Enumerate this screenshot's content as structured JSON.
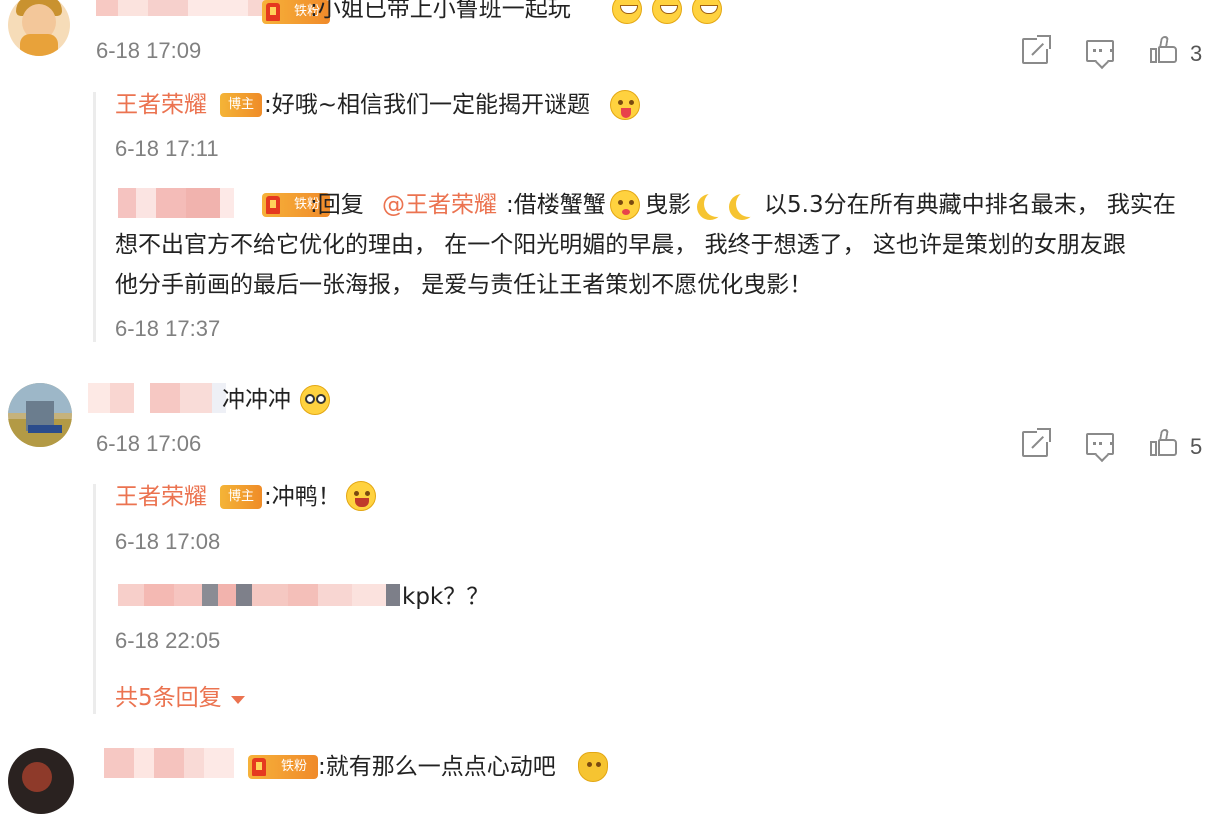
{
  "comments": [
    {
      "badge": "铁粉",
      "text": ":小姐已带上小鲁班一起玩",
      "time": "6-18 17:09",
      "likes": "3",
      "replies": [
        {
          "author": "王者荣耀",
          "badge": "博主",
          "text": ":好哦~相信我们一定能揭开谜题",
          "time": "6-18 17:11"
        },
        {
          "badge": "铁粉",
          "reply_prefix": ":回复",
          "mention": "@王者荣耀",
          "text_a": ":借楼蟹蟹",
          "text_b": "曳影",
          "text_c": "以5.3分在所有典藏中排名最末， 我实在",
          "line2": "想不出官方不给它优化的理由， 在一个阳光明媚的早晨， 我终于想透了， 这也许是策划的女朋友跟",
          "line3": "他分手前画的最后一张海报， 是爱与责任让王者策划不愿优化曳影！",
          "time": "6-18 17:37"
        }
      ]
    },
    {
      "text": "冲冲冲",
      "time": "6-18 17:06",
      "likes": "5",
      "replies": [
        {
          "author": "王者荣耀",
          "badge": "博主",
          "text": ":冲鸭！",
          "time": "6-18 17:08"
        },
        {
          "text": "kpk？？",
          "time": "6-18 22:05"
        }
      ],
      "more_replies": "共5条回复"
    },
    {
      "badge": "铁粉",
      "text": ":就有那么一点点心动吧"
    }
  ],
  "icons": {
    "share": "share-icon",
    "comment": "comment-icon",
    "like": "thumbs-up-icon"
  },
  "colors": {
    "accent": "#eb7350",
    "time": "#808080",
    "badge": "#f39c33"
  }
}
